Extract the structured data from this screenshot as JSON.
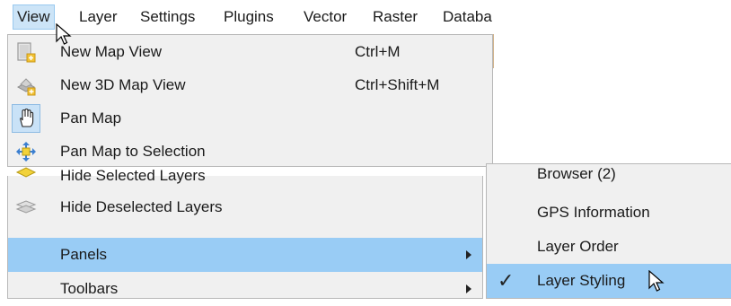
{
  "menubar": {
    "items": [
      "View",
      "Layer",
      "Settings",
      "Plugins",
      "Vector",
      "Raster",
      "Databa"
    ]
  },
  "view_menu": {
    "items": [
      {
        "label": "New Map View",
        "shortcut": "Ctrl+M",
        "icon": "new-map-view-icon"
      },
      {
        "label": "New 3D Map View",
        "shortcut": "Ctrl+Shift+M",
        "icon": "new-3d-map-view-icon"
      },
      {
        "label": "Pan Map",
        "shortcut": "",
        "icon": "hand-icon"
      },
      {
        "label": "Pan Map to Selection",
        "shortcut": "",
        "icon": "pan-to-selection-icon"
      }
    ],
    "lower_items": [
      {
        "label": "Hide Selected Layers",
        "icon": "hide-selected-layers-icon"
      },
      {
        "label": "Hide Deselected Layers",
        "icon": "hide-deselected-layers-icon"
      },
      {
        "label": "Panels",
        "has_submenu": true
      },
      {
        "label": "Toolbars",
        "has_submenu": true
      }
    ]
  },
  "panels_submenu": {
    "items": [
      {
        "label": "Browser (2)",
        "checked": false
      },
      {
        "label": "GPS Information",
        "checked": false
      },
      {
        "label": "Layer Order",
        "checked": false
      },
      {
        "label": "Layer Styling",
        "checked": true
      }
    ]
  },
  "colors": {
    "menu_bg": "#f0f0f0",
    "highlight": "#99ccf5",
    "menubar_active": "#cce4f7"
  }
}
